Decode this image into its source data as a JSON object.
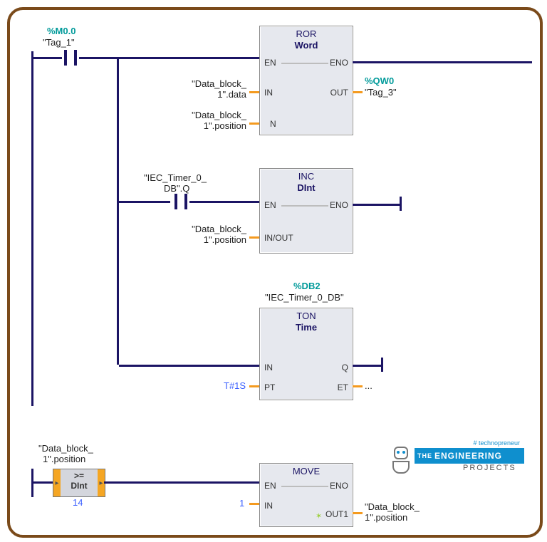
{
  "rung1": {
    "addr": "%M0.0",
    "tag": "\"Tag_1\""
  },
  "blocks": {
    "ror": {
      "title1": "ROR",
      "title2": "Word",
      "en": "EN",
      "eno": "ENO",
      "in": "IN",
      "out": "OUT",
      "n": "N",
      "in_label_l1": "\"Data_block_",
      "in_label_l2": "1\".data",
      "n_label_l1": "\"Data_block_",
      "n_label_l2": "1\".position",
      "out_addr": "%QW0",
      "out_tag": "\"Tag_3\""
    },
    "inc": {
      "title1": "INC",
      "title2": "DInt",
      "en": "EN",
      "eno": "ENO",
      "inout": "IN/OUT",
      "contact_l1": "\"IEC_Timer_0_",
      "contact_l2": "DB\".Q",
      "inout_label_l1": "\"Data_block_",
      "inout_label_l2": "1\".position"
    },
    "ton": {
      "db": "%DB2",
      "dbname": "\"IEC_Timer_0_DB\"",
      "title1": "TON",
      "title2": "Time",
      "in": "IN",
      "q": "Q",
      "pt": "PT",
      "et": "ET",
      "pt_val": "T#1S",
      "et_val": "..."
    },
    "move": {
      "title": "MOVE",
      "en": "EN",
      "eno": "ENO",
      "in": "IN",
      "out1": "OUT1",
      "in_val": "1",
      "out_label_l1": "\"Data_block_",
      "out_label_l2": "1\".position"
    }
  },
  "compare": {
    "label_l1": "\"Data_block_",
    "label_l2": "1\".position",
    "op": ">=",
    "dtype": "DInt",
    "value": "14"
  },
  "logo": {
    "hash": "# technopreneur",
    "the": "THE",
    "eng": "ENGINEERING",
    "projects": "PROJECTS"
  }
}
